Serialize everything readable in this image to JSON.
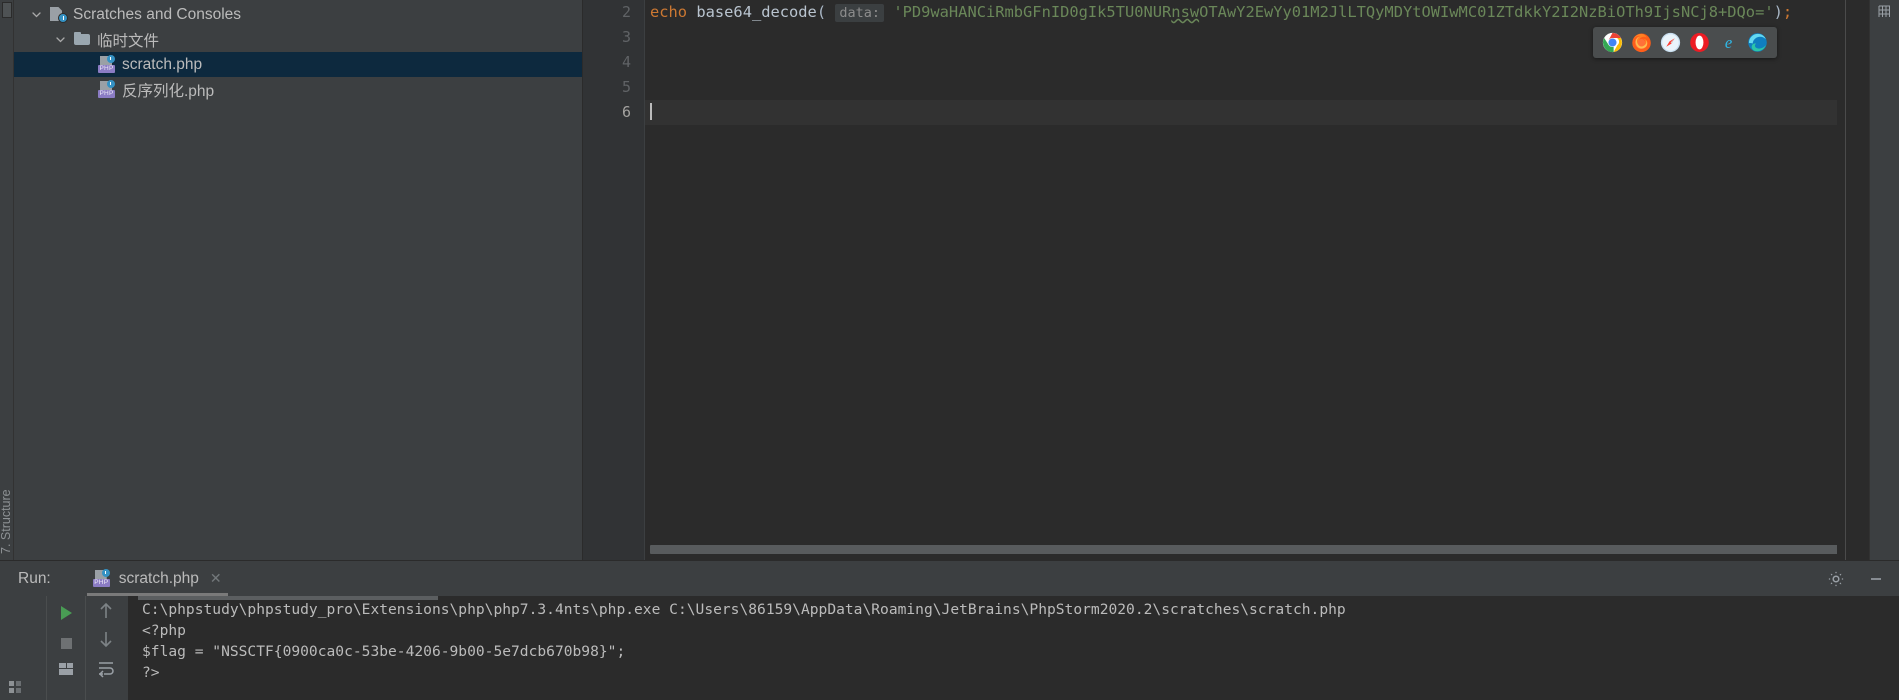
{
  "project_tree": {
    "name": "Scratches and Consoles tree",
    "items": [
      {
        "label": "Scratches and Consoles",
        "icon": "scratch-root-icon",
        "expanded": true,
        "depth": 0,
        "selected": false
      },
      {
        "label": "临时文件",
        "icon": "folder-icon",
        "expanded": true,
        "depth": 1,
        "selected": false
      },
      {
        "label": "scratch.php",
        "icon": "php-scratch-icon",
        "depth": 2,
        "selected": true
      },
      {
        "label": "反序列化.php",
        "icon": "php-scratch-icon",
        "depth": 2,
        "selected": false
      }
    ]
  },
  "editor": {
    "line_numbers": [
      "2",
      "3",
      "4",
      "5",
      "6"
    ],
    "current_line_index": 4,
    "code": {
      "keyword": "echo",
      "function": "base64_decode",
      "paren_open": "(",
      "param_hint": "data:",
      "string_part1": "'PD9waHANCiRmbGFnID0gIk5TU0NUR",
      "string_underlined": "nsw",
      "string_part2": "OTAwY2EwYy01M2JlLTQyMDYtOWIwMC01ZTdkkY2I2NzBiOTh9IjsNCj8+DQo='",
      "string_full": "'PD9waHANCiRmbGFnID0gIk5TU0NUR nswOTAwY2EwYy01M2JlLTQyMDYtOWIwMC01ZTdkkY2I2NzBiOTh9IjsNCj8+DQo='",
      "paren_close": ")",
      "semicolon": ";"
    },
    "browser_popup": {
      "name": "open-in-browser-popup",
      "browsers": [
        {
          "name": "chrome-icon",
          "label": "Chrome"
        },
        {
          "name": "firefox-icon",
          "label": "Firefox"
        },
        {
          "name": "safari-icon",
          "label": "Safari"
        },
        {
          "name": "opera-icon",
          "label": "Opera"
        },
        {
          "name": "internet-explorer-icon",
          "label": "Internet Explorer"
        },
        {
          "name": "edge-icon",
          "label": "Edge"
        }
      ]
    }
  },
  "run_panel": {
    "label": "Run:",
    "tab_label": "scratch.php",
    "tab_close": "✕",
    "vertical_label": "7. Structure",
    "settings_icon": "gear-icon",
    "minimize_icon": "minimize-icon",
    "console_lines": [
      "C:\\phpstudy\\phpstudy_pro\\Extensions\\php\\php7.3.4nts\\php.exe C:\\Users\\86159\\AppData\\Roaming\\JetBrains\\PhpStorm2020.2\\scratches\\scratch.php",
      "<?php",
      "$flag = \"NSSCTF{0900ca0c-53be-4206-9b00-5e7dcb670b98}\";",
      "?>"
    ],
    "buttons": [
      {
        "name": "run-button",
        "glyph": "▶"
      },
      {
        "name": "stop-button",
        "glyph": "■"
      },
      {
        "name": "scroll-up-button",
        "glyph": "↑"
      },
      {
        "name": "scroll-down-button",
        "glyph": "↓"
      },
      {
        "name": "soft-wrap-button",
        "glyph": "⇥"
      },
      {
        "name": "layout-button",
        "glyph": "▤"
      }
    ]
  },
  "colors": {
    "bg": "#3c3f41",
    "editor_bg": "#2b2b2b",
    "gutter_bg": "#313335",
    "selection": "#0d293e",
    "keyword": "#cc7832",
    "string": "#6a8759",
    "text": "#bbbbbb",
    "muted": "#606366",
    "run_green": "#499c54"
  }
}
